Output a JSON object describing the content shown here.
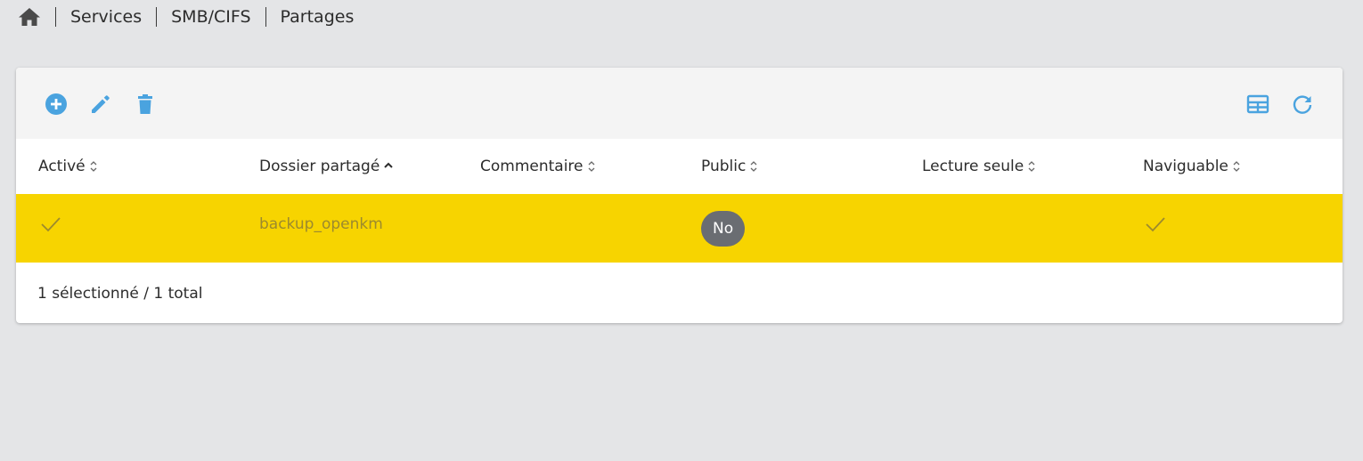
{
  "breadcrumb": {
    "home_icon": "home-icon",
    "items": [
      "Services",
      "SMB/CIFS",
      "Partages"
    ]
  },
  "toolbar": {
    "left_icons": [
      "add-circle-icon",
      "pencil-icon",
      "trash-icon"
    ],
    "right_icons": [
      "table-columns-icon",
      "refresh-icon"
    ],
    "accent_color": "#4aa3df"
  },
  "table": {
    "columns": [
      {
        "label": "Activé",
        "sort": "none"
      },
      {
        "label": "Dossier partagé",
        "sort": "ascending"
      },
      {
        "label": "Commentaire",
        "sort": "none"
      },
      {
        "label": "Public",
        "sort": "none"
      },
      {
        "label": "Lecture seule",
        "sort": "none"
      },
      {
        "label": "Naviguable",
        "sort": "none"
      }
    ],
    "rows": [
      {
        "enabled": true,
        "enabled_icon": "check-icon",
        "shared_folder": "backup_openkm",
        "comment": "",
        "public": "No",
        "read_only": "",
        "browsable": true,
        "browsable_icon": "check-icon",
        "selected": true
      }
    ],
    "selected_row_color": "#f7d400"
  },
  "footer": {
    "status": "1 sélectionné / 1 total"
  }
}
